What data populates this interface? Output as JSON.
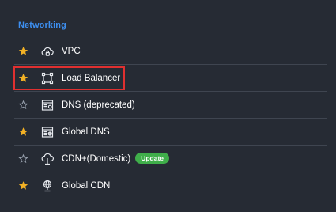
{
  "section": {
    "title": "Networking"
  },
  "items": [
    {
      "label": "VPC",
      "favorited": true,
      "icon": "cloud-lock-icon",
      "badge": ""
    },
    {
      "label": "Load Balancer",
      "favorited": true,
      "icon": "load-balancer-icon",
      "badge": ""
    },
    {
      "label": "DNS (deprecated)",
      "favorited": false,
      "icon": "dns-icon",
      "badge": ""
    },
    {
      "label": "Global DNS",
      "favorited": true,
      "icon": "global-dns-icon",
      "badge": ""
    },
    {
      "label": "CDN+(Domestic)",
      "favorited": false,
      "icon": "cdn-icon",
      "badge": "Update"
    },
    {
      "label": "Global CDN",
      "favorited": true,
      "icon": "global-cdn-icon",
      "badge": ""
    }
  ],
  "colors": {
    "background": "#262b34",
    "accent": "#3d8ff0",
    "star_filled": "#f2b125",
    "star_empty": "#9aa3b0",
    "badge": "#3fae4a",
    "highlight": "#e03030"
  }
}
